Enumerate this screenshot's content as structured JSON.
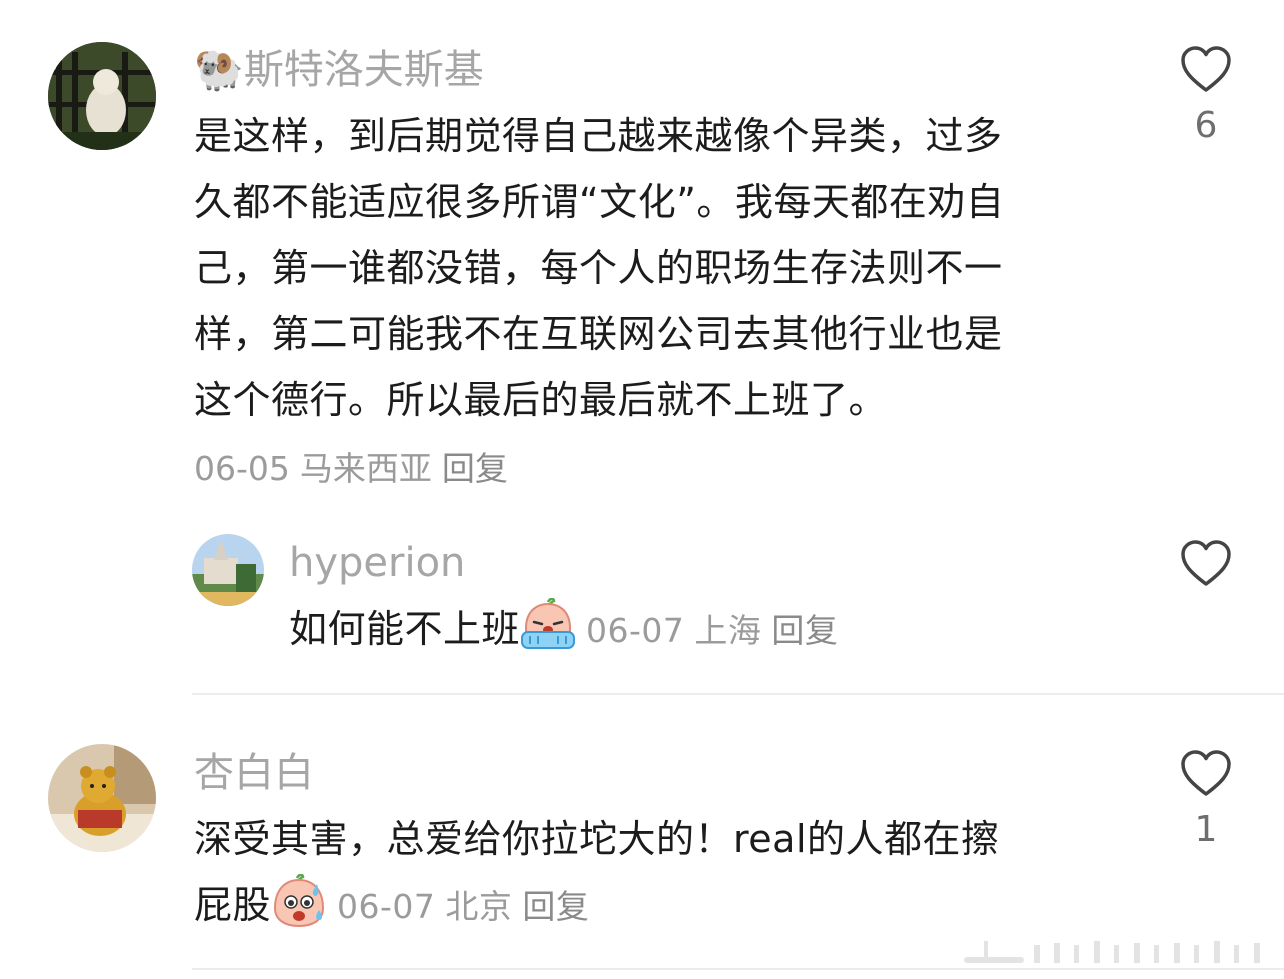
{
  "comments": [
    {
      "user_emoji": "🐏",
      "username": "斯特洛夫斯基",
      "lines": [
        "是这样，到后期觉得自己越来越像个异类，过多",
        "久都不能适应很多所谓“文化”。我每天都在劝自",
        "己，第一谁都没错，每个人的职场生存法则不一",
        "样，第二可能我不在互联网公司去其他行业也是",
        "这个德行。所以最后的最后就不上班了。"
      ],
      "date": "06-05",
      "location": "马来西亚",
      "reply_label": "回复",
      "like_count": "6",
      "reply": {
        "username": "hyperion",
        "text": "如何能不上班",
        "emoji": "crying-face",
        "date": "06-07",
        "location": "上海",
        "reply_label": "回复",
        "like_count": ""
      }
    },
    {
      "username": "杏白白",
      "lines": [
        "深受其害，总爱给你拉坨大的！real的人都在擦"
      ],
      "last_line": "屁股",
      "emoji": "sweat-face",
      "date": "06-07",
      "location": "北京",
      "reply_label": "回复",
      "like_count": "1"
    }
  ],
  "icons": {
    "like": "heart-outline-icon"
  },
  "colors": {
    "username": "#a6a6a6",
    "text": "#1c1c1c",
    "meta": "#9b9b9b",
    "divider": "#ececec"
  }
}
